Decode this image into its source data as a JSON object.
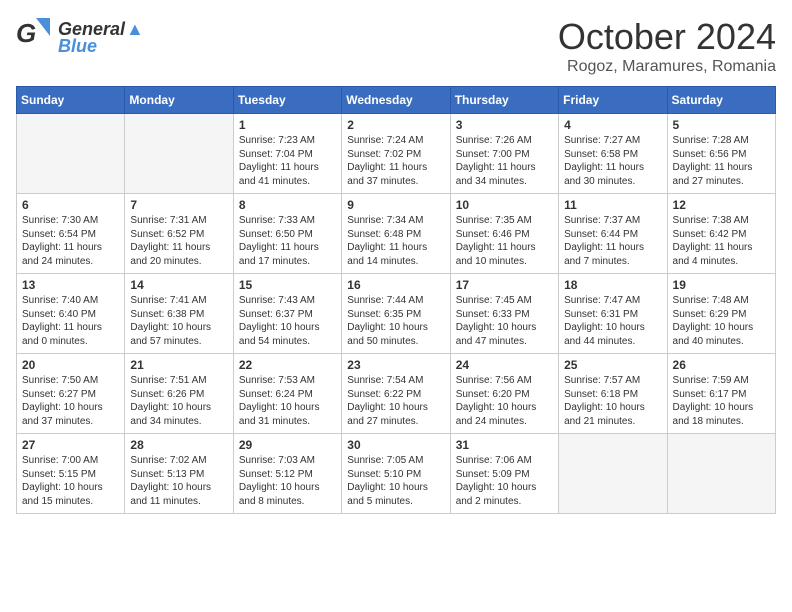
{
  "header": {
    "logo_general": "General",
    "logo_blue": "Blue",
    "month": "October 2024",
    "location": "Rogoz, Maramures, Romania"
  },
  "days_of_week": [
    "Sunday",
    "Monday",
    "Tuesday",
    "Wednesday",
    "Thursday",
    "Friday",
    "Saturday"
  ],
  "weeks": [
    [
      {
        "day": "",
        "info": ""
      },
      {
        "day": "",
        "info": ""
      },
      {
        "day": "1",
        "info": "Sunrise: 7:23 AM\nSunset: 7:04 PM\nDaylight: 11 hours and 41 minutes."
      },
      {
        "day": "2",
        "info": "Sunrise: 7:24 AM\nSunset: 7:02 PM\nDaylight: 11 hours and 37 minutes."
      },
      {
        "day": "3",
        "info": "Sunrise: 7:26 AM\nSunset: 7:00 PM\nDaylight: 11 hours and 34 minutes."
      },
      {
        "day": "4",
        "info": "Sunrise: 7:27 AM\nSunset: 6:58 PM\nDaylight: 11 hours and 30 minutes."
      },
      {
        "day": "5",
        "info": "Sunrise: 7:28 AM\nSunset: 6:56 PM\nDaylight: 11 hours and 27 minutes."
      }
    ],
    [
      {
        "day": "6",
        "info": "Sunrise: 7:30 AM\nSunset: 6:54 PM\nDaylight: 11 hours and 24 minutes."
      },
      {
        "day": "7",
        "info": "Sunrise: 7:31 AM\nSunset: 6:52 PM\nDaylight: 11 hours and 20 minutes."
      },
      {
        "day": "8",
        "info": "Sunrise: 7:33 AM\nSunset: 6:50 PM\nDaylight: 11 hours and 17 minutes."
      },
      {
        "day": "9",
        "info": "Sunrise: 7:34 AM\nSunset: 6:48 PM\nDaylight: 11 hours and 14 minutes."
      },
      {
        "day": "10",
        "info": "Sunrise: 7:35 AM\nSunset: 6:46 PM\nDaylight: 11 hours and 10 minutes."
      },
      {
        "day": "11",
        "info": "Sunrise: 7:37 AM\nSunset: 6:44 PM\nDaylight: 11 hours and 7 minutes."
      },
      {
        "day": "12",
        "info": "Sunrise: 7:38 AM\nSunset: 6:42 PM\nDaylight: 11 hours and 4 minutes."
      }
    ],
    [
      {
        "day": "13",
        "info": "Sunrise: 7:40 AM\nSunset: 6:40 PM\nDaylight: 11 hours and 0 minutes."
      },
      {
        "day": "14",
        "info": "Sunrise: 7:41 AM\nSunset: 6:38 PM\nDaylight: 10 hours and 57 minutes."
      },
      {
        "day": "15",
        "info": "Sunrise: 7:43 AM\nSunset: 6:37 PM\nDaylight: 10 hours and 54 minutes."
      },
      {
        "day": "16",
        "info": "Sunrise: 7:44 AM\nSunset: 6:35 PM\nDaylight: 10 hours and 50 minutes."
      },
      {
        "day": "17",
        "info": "Sunrise: 7:45 AM\nSunset: 6:33 PM\nDaylight: 10 hours and 47 minutes."
      },
      {
        "day": "18",
        "info": "Sunrise: 7:47 AM\nSunset: 6:31 PM\nDaylight: 10 hours and 44 minutes."
      },
      {
        "day": "19",
        "info": "Sunrise: 7:48 AM\nSunset: 6:29 PM\nDaylight: 10 hours and 40 minutes."
      }
    ],
    [
      {
        "day": "20",
        "info": "Sunrise: 7:50 AM\nSunset: 6:27 PM\nDaylight: 10 hours and 37 minutes."
      },
      {
        "day": "21",
        "info": "Sunrise: 7:51 AM\nSunset: 6:26 PM\nDaylight: 10 hours and 34 minutes."
      },
      {
        "day": "22",
        "info": "Sunrise: 7:53 AM\nSunset: 6:24 PM\nDaylight: 10 hours and 31 minutes."
      },
      {
        "day": "23",
        "info": "Sunrise: 7:54 AM\nSunset: 6:22 PM\nDaylight: 10 hours and 27 minutes."
      },
      {
        "day": "24",
        "info": "Sunrise: 7:56 AM\nSunset: 6:20 PM\nDaylight: 10 hours and 24 minutes."
      },
      {
        "day": "25",
        "info": "Sunrise: 7:57 AM\nSunset: 6:18 PM\nDaylight: 10 hours and 21 minutes."
      },
      {
        "day": "26",
        "info": "Sunrise: 7:59 AM\nSunset: 6:17 PM\nDaylight: 10 hours and 18 minutes."
      }
    ],
    [
      {
        "day": "27",
        "info": "Sunrise: 7:00 AM\nSunset: 5:15 PM\nDaylight: 10 hours and 15 minutes."
      },
      {
        "day": "28",
        "info": "Sunrise: 7:02 AM\nSunset: 5:13 PM\nDaylight: 10 hours and 11 minutes."
      },
      {
        "day": "29",
        "info": "Sunrise: 7:03 AM\nSunset: 5:12 PM\nDaylight: 10 hours and 8 minutes."
      },
      {
        "day": "30",
        "info": "Sunrise: 7:05 AM\nSunset: 5:10 PM\nDaylight: 10 hours and 5 minutes."
      },
      {
        "day": "31",
        "info": "Sunrise: 7:06 AM\nSunset: 5:09 PM\nDaylight: 10 hours and 2 minutes."
      },
      {
        "day": "",
        "info": ""
      },
      {
        "day": "",
        "info": ""
      }
    ]
  ]
}
